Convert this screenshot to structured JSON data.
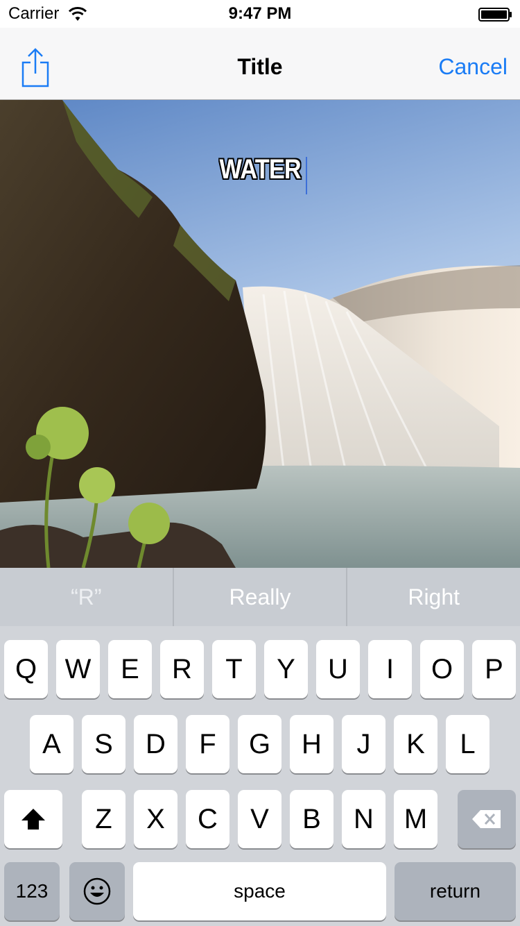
{
  "status_bar": {
    "carrier": "Carrier",
    "time": "9:47 PM",
    "wifi_icon": "wifi-icon",
    "battery_icon": "battery-icon"
  },
  "nav": {
    "title": "Title",
    "cancel_label": "Cancel",
    "share_icon": "share-icon",
    "accent_color": "#1a7cf5"
  },
  "photo": {
    "caption": "WATER",
    "description_icon": "waterfall-photo"
  },
  "suggestions": [
    "“R”",
    "Really",
    "Right"
  ],
  "keyboard": {
    "row1": [
      "Q",
      "W",
      "E",
      "R",
      "T",
      "Y",
      "U",
      "I",
      "O",
      "P"
    ],
    "row2": [
      "A",
      "S",
      "D",
      "F",
      "G",
      "H",
      "J",
      "K",
      "L"
    ],
    "row3": [
      "Z",
      "X",
      "C",
      "V",
      "B",
      "N",
      "M"
    ],
    "numbers_label": "123",
    "space_label": "space",
    "return_label": "return",
    "shift_icon": "shift-icon",
    "delete_icon": "delete-icon",
    "emoji_icon": "emoji-icon"
  }
}
